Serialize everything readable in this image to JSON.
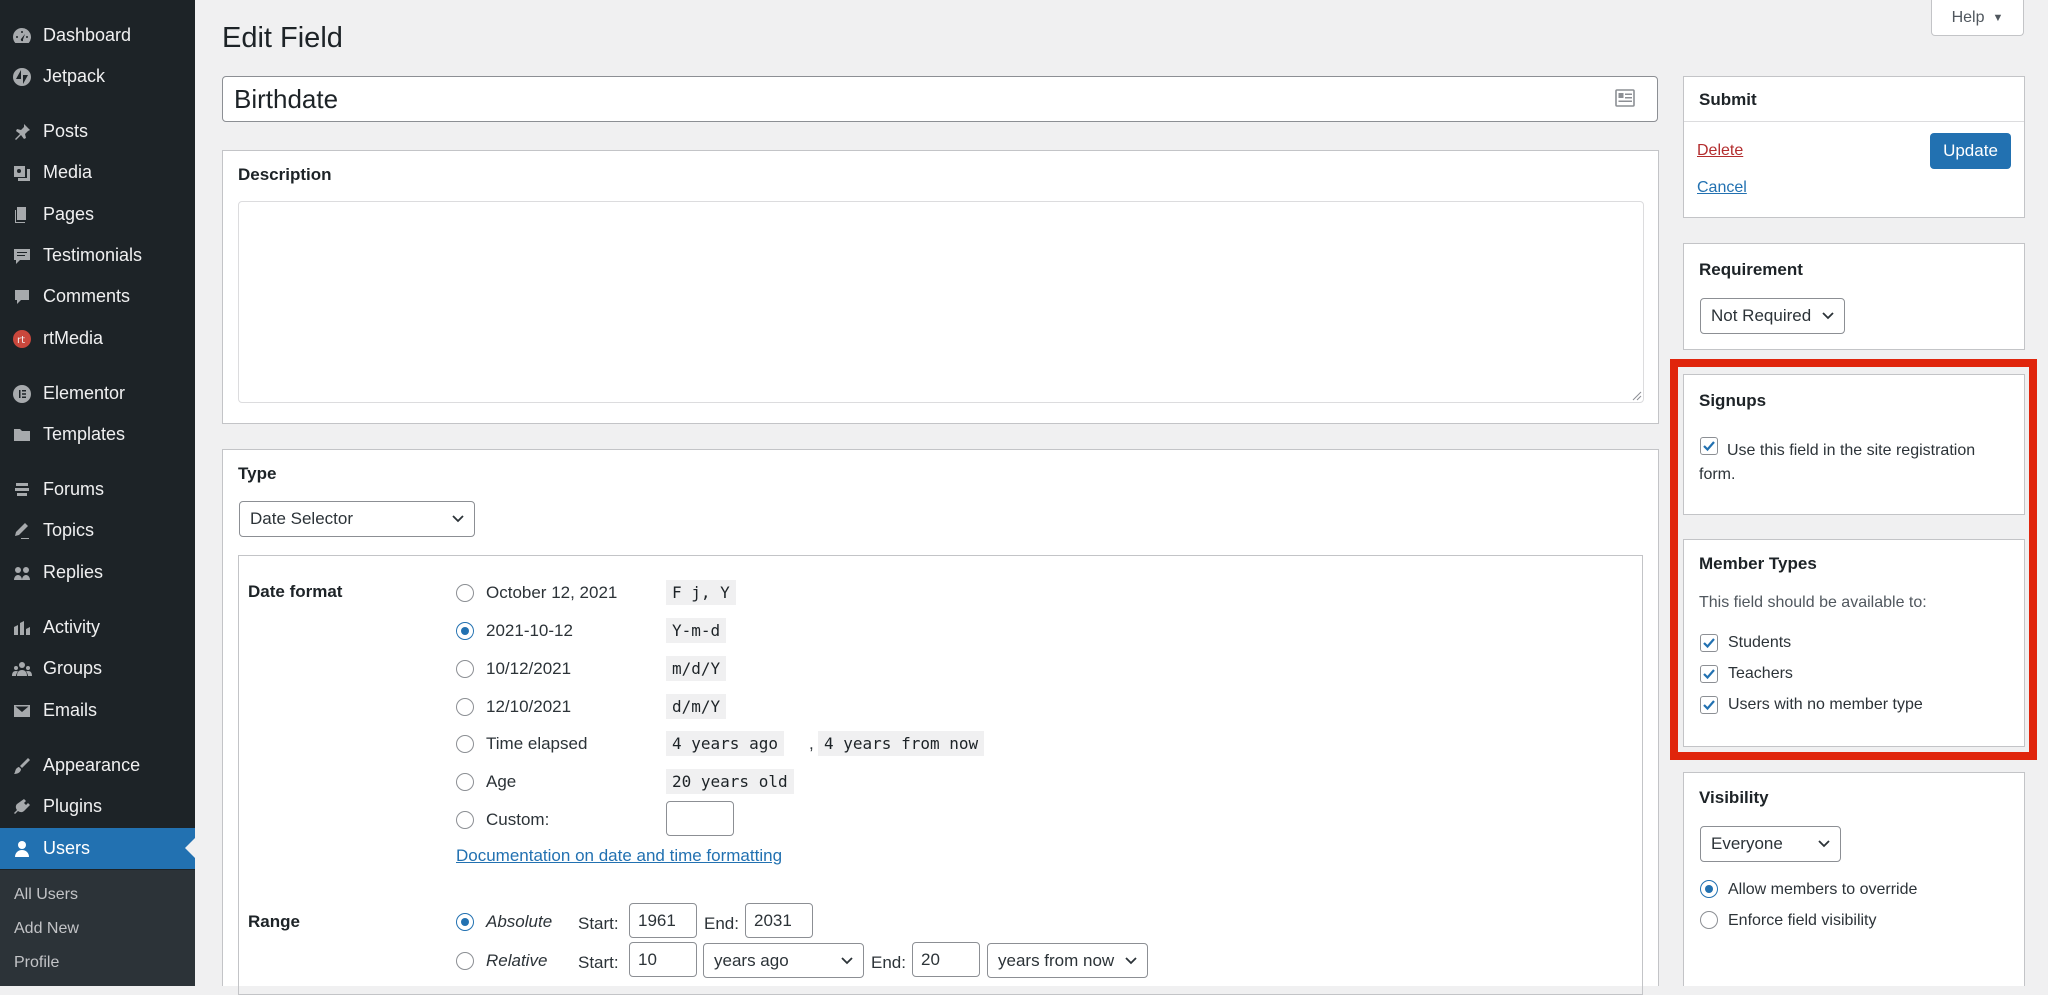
{
  "sidebar": {
    "items": [
      {
        "label": "Dashboard",
        "icon": "dashboard-icon"
      },
      {
        "label": "Jetpack",
        "icon": "jetpack-icon"
      },
      {
        "label": "Posts",
        "icon": "pin-icon"
      },
      {
        "label": "Media",
        "icon": "media-icon"
      },
      {
        "label": "Pages",
        "icon": "pages-icon"
      },
      {
        "label": "Testimonials",
        "icon": "testimonials-icon"
      },
      {
        "label": "Comments",
        "icon": "comments-icon"
      },
      {
        "label": "rtMedia",
        "icon": "rtmedia-icon"
      },
      {
        "label": "Elementor",
        "icon": "elementor-icon"
      },
      {
        "label": "Templates",
        "icon": "folder-icon"
      },
      {
        "label": "Forums",
        "icon": "forums-icon"
      },
      {
        "label": "Topics",
        "icon": "topics-icon"
      },
      {
        "label": "Replies",
        "icon": "replies-icon"
      },
      {
        "label": "Activity",
        "icon": "activity-icon"
      },
      {
        "label": "Groups",
        "icon": "groups-icon"
      },
      {
        "label": "Emails",
        "icon": "email-icon"
      },
      {
        "label": "Appearance",
        "icon": "paintbrush-icon"
      },
      {
        "label": "Plugins",
        "icon": "plugin-icon"
      },
      {
        "label": "Users",
        "icon": "user-icon"
      }
    ],
    "submenu": [
      "All Users",
      "Add New",
      "Profile"
    ]
  },
  "header": {
    "help_label": "Help",
    "title": "Edit Field"
  },
  "field": {
    "name": "Birthdate"
  },
  "description": {
    "title": "Description",
    "value": ""
  },
  "type": {
    "title": "Type",
    "selected": "Date Selector",
    "date_format": {
      "label": "Date format",
      "options": [
        {
          "label": "October 12, 2021",
          "code": "F j, Y",
          "checked": false
        },
        {
          "label": "2021-10-12",
          "code": "Y-m-d",
          "checked": true
        },
        {
          "label": "10/12/2021",
          "code": "m/d/Y",
          "checked": false
        },
        {
          "label": "12/10/2021",
          "code": "d/m/Y",
          "checked": false
        },
        {
          "label": "Time elapsed",
          "code": "4 years ago",
          "code2": "4 years from now",
          "sep": ",",
          "checked": false
        },
        {
          "label": "Age",
          "code": "20 years old",
          "checked": false
        },
        {
          "label": "Custom:",
          "checked": false
        }
      ],
      "doc_link": "Documentation on date and time formatting"
    },
    "range": {
      "label": "Range",
      "absolute": {
        "label": "Absolute",
        "start_label": "Start:",
        "start": "1961",
        "end_label": "End:",
        "end": "2031",
        "checked": true
      },
      "relative": {
        "label": "Relative",
        "start_label": "Start:",
        "start": "10",
        "start_unit": "years ago",
        "end_label": "End:",
        "end": "20",
        "end_unit": "years from now",
        "checked": false
      }
    }
  },
  "submit": {
    "title": "Submit",
    "delete_label": "Delete",
    "cancel_label": "Cancel",
    "update_label": "Update"
  },
  "requirement": {
    "title": "Requirement",
    "selected": "Not Required"
  },
  "signups": {
    "title": "Signups",
    "checkbox_label": "Use this field in the site registration form.",
    "checked": true
  },
  "member_types": {
    "title": "Member Types",
    "intro": "This field should be available to:",
    "options": [
      {
        "label": "Students",
        "checked": true
      },
      {
        "label": "Teachers",
        "checked": true
      },
      {
        "label": "Users with no member type",
        "checked": true
      }
    ]
  },
  "visibility": {
    "title": "Visibility",
    "selected": "Everyone",
    "options": [
      {
        "label": "Allow members to override",
        "checked": true
      },
      {
        "label": "Enforce field visibility",
        "checked": false
      }
    ]
  },
  "colors": {
    "accent": "#2271b1",
    "sidebar_bg": "#1d2327",
    "highlight": "#e0250c",
    "delete": "#b32d2e"
  }
}
